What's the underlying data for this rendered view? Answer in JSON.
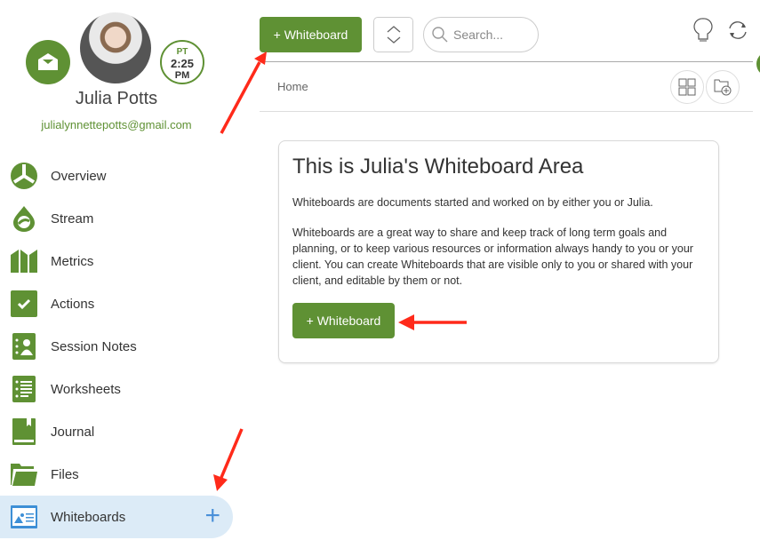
{
  "profile": {
    "name": "Julia Potts",
    "email": "julialynnettepotts@gmail.com",
    "timezone": "PT",
    "time": "2:25",
    "ampm": "PM"
  },
  "sidebar": {
    "items": [
      {
        "label": "Overview",
        "icon": "overview-icon"
      },
      {
        "label": "Stream",
        "icon": "stream-icon"
      },
      {
        "label": "Metrics",
        "icon": "metrics-icon"
      },
      {
        "label": "Actions",
        "icon": "checkbox-icon"
      },
      {
        "label": "Session Notes",
        "icon": "session-notes-icon"
      },
      {
        "label": "Worksheets",
        "icon": "worksheet-icon"
      },
      {
        "label": "Journal",
        "icon": "journal-icon"
      },
      {
        "label": "Files",
        "icon": "folder-icon"
      },
      {
        "label": "Whiteboards",
        "icon": "whiteboard-icon",
        "active": true,
        "add": "+"
      }
    ]
  },
  "toolbar": {
    "add_label": "+ Whiteboard",
    "search_placeholder": "Search..."
  },
  "breadcrumb": {
    "home": "Home"
  },
  "card": {
    "title": "This is Julia's Whiteboard Area",
    "p1": "Whiteboards are documents started and worked on by either you or Julia.",
    "p2": "Whiteboards are a great way to share and keep track of long term goals and planning, or to keep various resources or information always handy to you or your client. You can create Whiteboards that are visible only to you or shared with your client, and editable by them or not.",
    "button": "+ Whiteboard"
  },
  "colors": {
    "brand": "#5f9134",
    "active_bg": "#dcebf7",
    "accent_blue": "#4a90d9",
    "annotation": "#ff2a1a"
  }
}
